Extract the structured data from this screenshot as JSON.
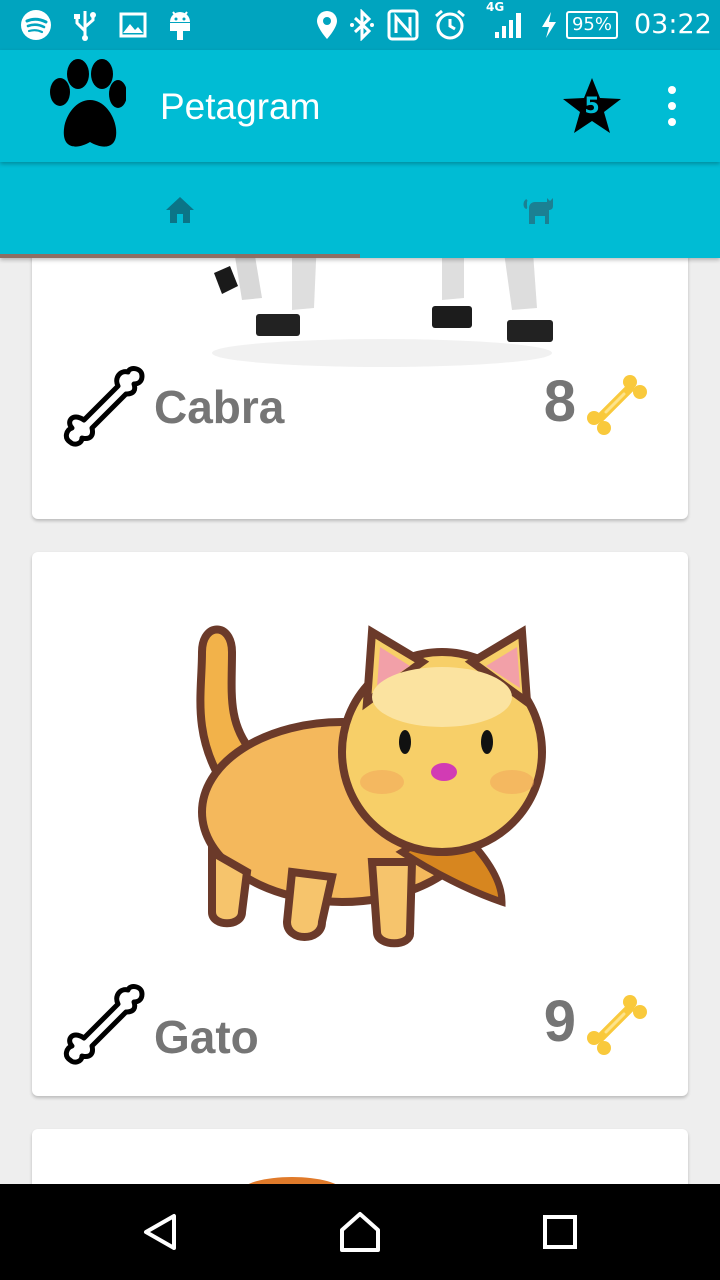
{
  "status_bar": {
    "network_label": "4G",
    "battery": "95%",
    "time": "03:22",
    "icons": [
      "spotify-icon",
      "usb-icon",
      "image-icon",
      "android-icon",
      "location-icon",
      "bluetooth-icon",
      "nfc-icon",
      "alarm-icon",
      "signal-icon",
      "charging-icon",
      "battery-icon"
    ]
  },
  "app_bar": {
    "title": "Petagram",
    "favorites_count": "5",
    "icons": [
      "paw-logo-icon",
      "star-icon",
      "more-vert-icon"
    ]
  },
  "tabs": [
    {
      "icon": "home-icon",
      "selected": true
    },
    {
      "icon": "cat-icon",
      "selected": false
    }
  ],
  "pets": [
    {
      "name": "Cabra",
      "rating": "8"
    },
    {
      "name": "Gato",
      "rating": "9"
    }
  ],
  "colors": {
    "primary": "#00bcd4",
    "primary_dark": "#00a4bf",
    "tab_indicator": "#8d6e63",
    "text_secondary": "#757575",
    "bone_gold": "#f9c93c"
  },
  "nav_bar": {
    "icons": [
      "back-icon",
      "home-nav-icon",
      "recents-icon"
    ]
  }
}
